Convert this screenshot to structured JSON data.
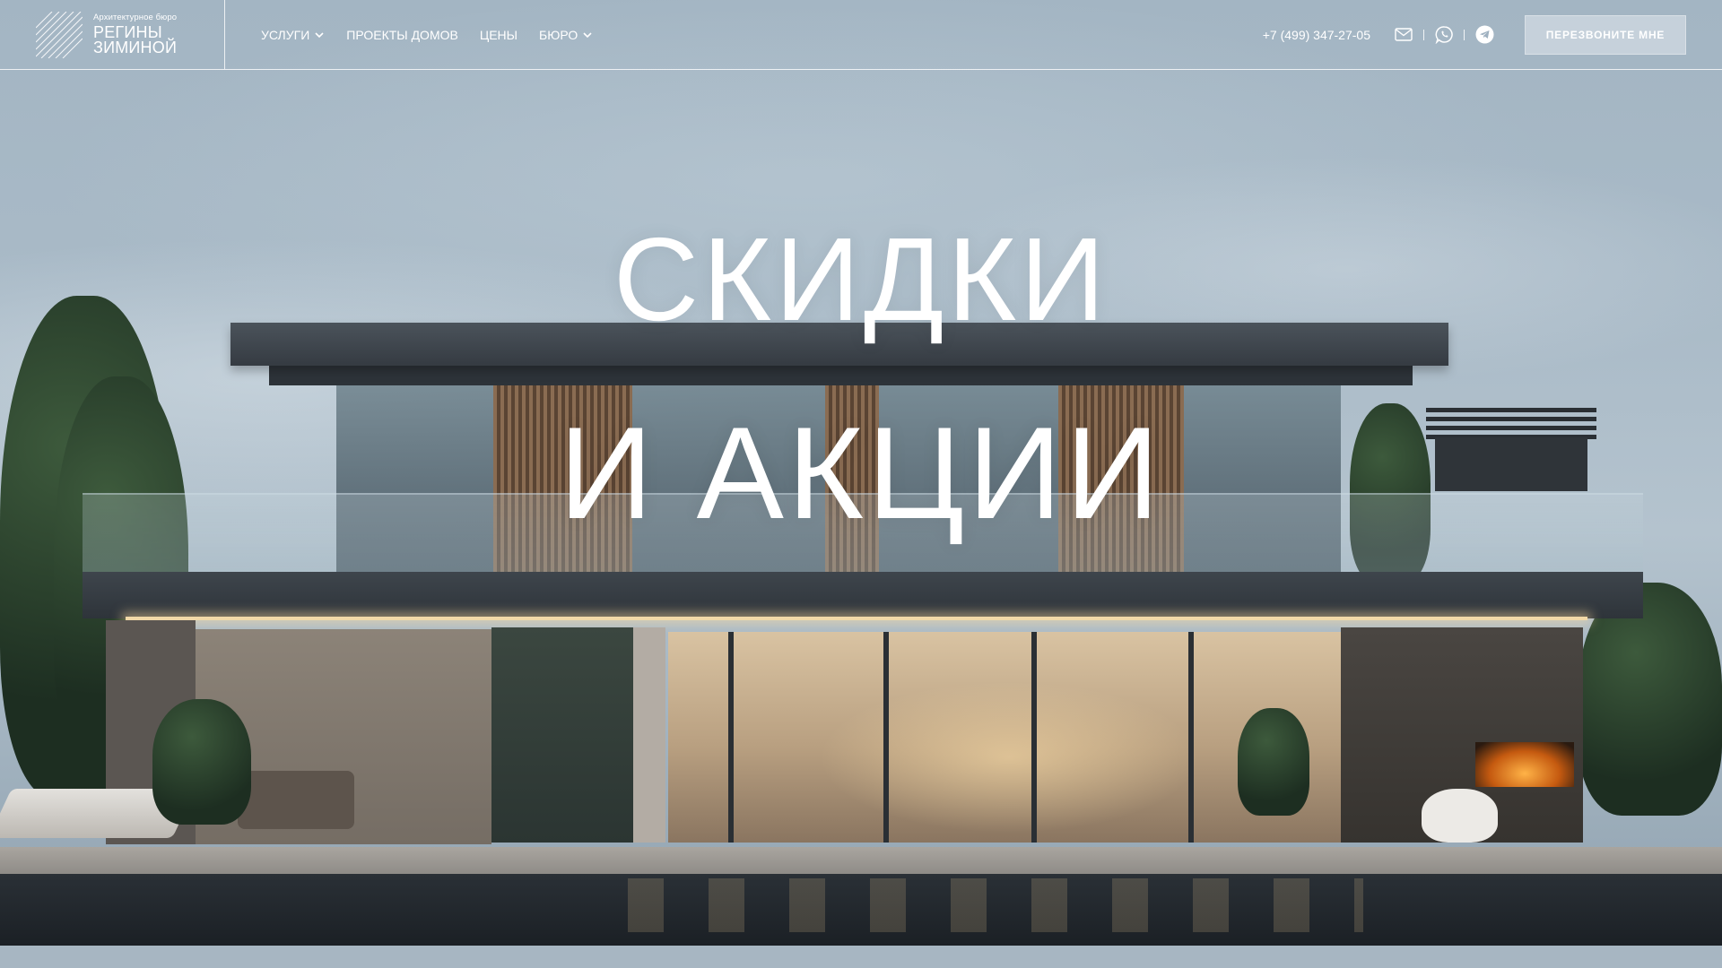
{
  "header": {
    "logo": {
      "subtitle": "Архитектурное бюро",
      "name_line1": "РЕГИНЫ",
      "name_line2": "ЗИМИНОЙ"
    },
    "nav": [
      {
        "label": "УСЛУГИ",
        "has_dropdown": true
      },
      {
        "label": "ПРОЕКТЫ ДОМОВ",
        "has_dropdown": false
      },
      {
        "label": "ЦЕНЫ",
        "has_dropdown": false
      },
      {
        "label": "БЮРО",
        "has_dropdown": true
      }
    ],
    "phone": "+7 (499) 347-27-05",
    "contact_icons": [
      "mail-icon",
      "whatsapp-icon",
      "telegram-icon"
    ],
    "callback_label": "ПЕРЕЗВОНИТЕ МНЕ"
  },
  "hero": {
    "line1": "СКИДКИ",
    "line2": "И АКЦИИ"
  },
  "colors": {
    "text": "#ffffff",
    "sky": "#a9bac7"
  }
}
